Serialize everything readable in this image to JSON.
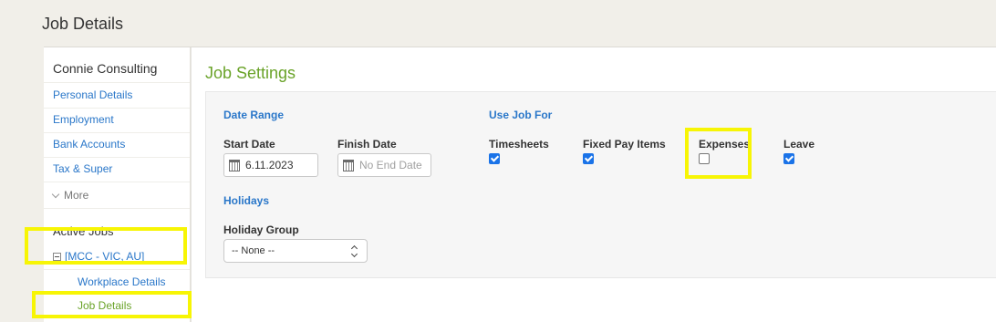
{
  "page": {
    "title": "Job Details"
  },
  "sidebar": {
    "employee_name": "Connie Consulting",
    "links": [
      {
        "label": "Personal Details"
      },
      {
        "label": "Employment"
      },
      {
        "label": "Bank Accounts"
      },
      {
        "label": "Tax & Super"
      }
    ],
    "more_label": "More",
    "active_jobs_header": "Active Jobs",
    "job": {
      "label": "[MCC - VIC, AU]",
      "children": [
        {
          "label": "Workplace Details"
        },
        {
          "label": "Job Details"
        }
      ]
    }
  },
  "main": {
    "title": "Job Settings",
    "date_range": {
      "section_label": "Date Range",
      "start_label": "Start Date",
      "start_value": "6.11.2023",
      "finish_label": "Finish Date",
      "finish_placeholder": "No End Date"
    },
    "use_job_for": {
      "section_label": "Use Job For",
      "options": [
        {
          "label": "Timesheets",
          "checked": true
        },
        {
          "label": "Fixed Pay Items",
          "checked": true
        },
        {
          "label": "Expenses",
          "checked": false
        },
        {
          "label": "Leave",
          "checked": true
        }
      ]
    },
    "holidays": {
      "section_label": "Holidays",
      "group_label": "Holiday Group",
      "group_value": "-- None --"
    }
  },
  "colors": {
    "link": "#2a77c9",
    "title_green": "#6aa329",
    "highlight": "#f7f505",
    "checkbox": "#1a73e8"
  }
}
